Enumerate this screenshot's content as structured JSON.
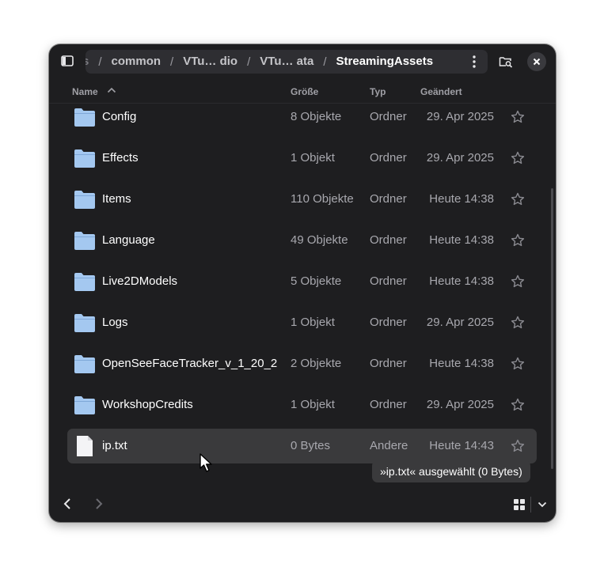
{
  "header": {
    "breadcrumbs": [
      {
        "label": "s",
        "clipped": true
      },
      {
        "label": "common"
      },
      {
        "label": "VTu… dio"
      },
      {
        "label": "VTu… ata"
      },
      {
        "label": "StreamingAssets",
        "current": true
      }
    ],
    "separator": "/"
  },
  "columns": {
    "name": "Name",
    "size": "Größe",
    "type": "Typ",
    "changed": "Geändert"
  },
  "rows": [
    {
      "name": "Config",
      "size": "8 Objekte",
      "type": "Ordner",
      "changed": "29. Apr 2025",
      "icon": "folder-icon"
    },
    {
      "name": "Effects",
      "size": "1 Objekt",
      "type": "Ordner",
      "changed": "29. Apr 2025",
      "icon": "folder-icon"
    },
    {
      "name": "Items",
      "size": "110 Objekte",
      "type": "Ordner",
      "changed": "Heute 14:38",
      "icon": "folder-icon"
    },
    {
      "name": "Language",
      "size": "49 Objekte",
      "type": "Ordner",
      "changed": "Heute 14:38",
      "icon": "folder-icon"
    },
    {
      "name": "Live2DModels",
      "size": "5 Objekte",
      "type": "Ordner",
      "changed": "Heute 14:38",
      "icon": "folder-icon"
    },
    {
      "name": "Logs",
      "size": "1 Objekt",
      "type": "Ordner",
      "changed": "29. Apr 2025",
      "icon": "folder-icon"
    },
    {
      "name": "OpenSeeFaceTracker_v_1_20_2",
      "size": "2 Objekte",
      "type": "Ordner",
      "changed": "Heute 14:38",
      "icon": "folder-icon"
    },
    {
      "name": "WorkshopCredits",
      "size": "1 Objekt",
      "type": "Ordner",
      "changed": "29. Apr 2025",
      "icon": "folder-icon"
    },
    {
      "name": "ip.txt",
      "size": "0 Bytes",
      "type": "Andere",
      "changed": "Heute 14:43",
      "icon": "text-file-icon",
      "selected": true
    }
  ],
  "status": "»ip.txt« ausgewählt  (0 Bytes)",
  "colors": {
    "window_bg": "#1e1e20",
    "folder": "#a4c8f0",
    "selected_row": "#3a3a3c"
  }
}
